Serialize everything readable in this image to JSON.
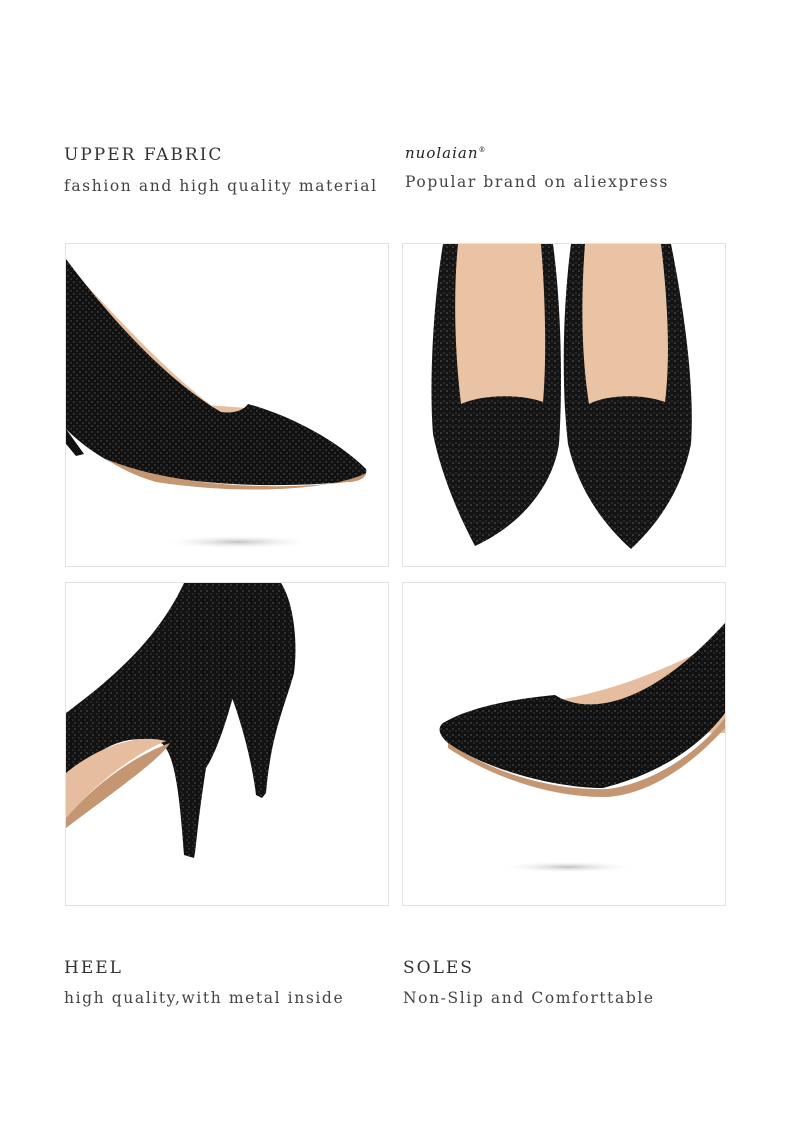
{
  "top_left": {
    "heading": "UPPER FABRIC",
    "subtitle": "fashion and high quality material"
  },
  "top_right": {
    "brand_logo": "NUOLAIAN",
    "trademark": "®",
    "subtitle": "Popular brand on aliexpress"
  },
  "bottom_left": {
    "heading": "HEEL",
    "subtitle": "high quality,with metal inside"
  },
  "bottom_right": {
    "heading": "SOLES",
    "subtitle": "Non-Slip and Comforttable"
  },
  "colors": {
    "shoe": "#101010",
    "lining": "#e6bd9e",
    "sole": "#c49672",
    "border": "#e2e2e2"
  }
}
